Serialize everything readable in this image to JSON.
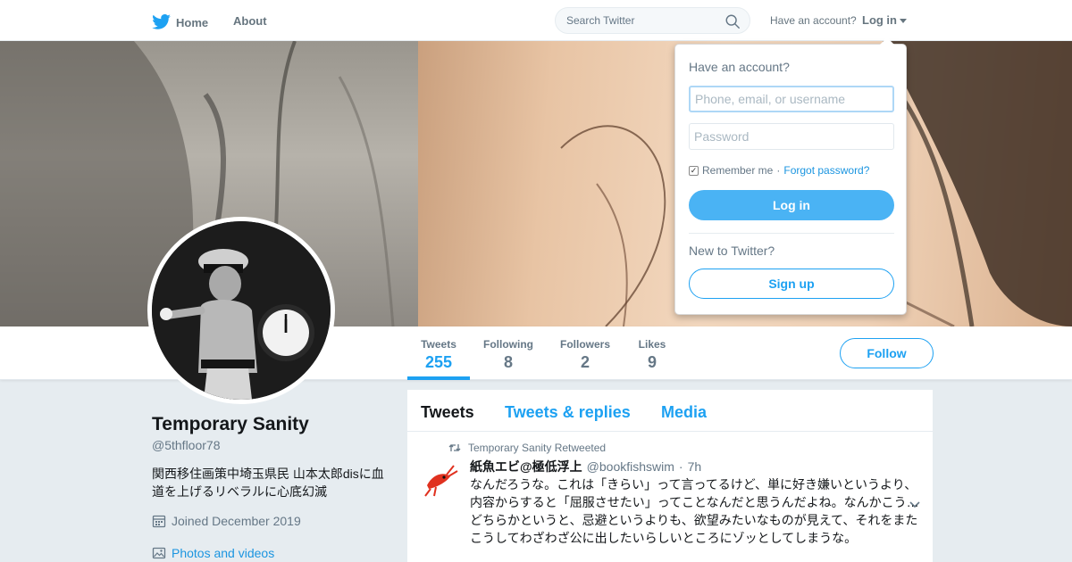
{
  "nav": {
    "home_label": "Home",
    "about_label": "About",
    "search_placeholder": "Search Twitter",
    "have_account": "Have an account?",
    "login_label": "Log in"
  },
  "profile": {
    "name": "Temporary Sanity",
    "handle": "@5thfloor78",
    "bio": "関西移住画策中埼玉県民 山本太郎disに血道を上げるリベラルに心底幻滅",
    "joined": "Joined December 2019",
    "photos_link": "Photos and videos"
  },
  "stats": [
    {
      "label": "Tweets",
      "value": "255"
    },
    {
      "label": "Following",
      "value": "8"
    },
    {
      "label": "Followers",
      "value": "2"
    },
    {
      "label": "Likes",
      "value": "9"
    }
  ],
  "follow_label": "Follow",
  "timeline": {
    "tabs": [
      "Tweets",
      "Tweets & replies",
      "Media"
    ],
    "tweet": {
      "retweeted_by": "Temporary Sanity Retweeted",
      "fullname": "紙魚エビ@極低浮上",
      "handle": "@bookfishswim",
      "separator": "·",
      "time": "7h",
      "lines": [
        "なんだろうな。これは「きらい」って言ってるけど、単に好き嫌いというより、",
        "内容からすると「屈服させたい」ってことなんだと思うんだよね。なんかこう…",
        "どちらかというと、忌避というよりも、欲望みたいなものが見えて、それをまた",
        "こうしてわざわざ公に出したいらしいところにゾッとしてしまうな。"
      ]
    }
  },
  "login_dropdown": {
    "title": "Have an account?",
    "username_placeholder": "Phone, email, or username",
    "password_placeholder": "Password",
    "remember": "Remember me",
    "separator": "·",
    "forgot": "Forgot password?",
    "login_button": "Log in",
    "new_to": "New to Twitter?",
    "signup_button": "Sign up"
  },
  "colors": {
    "brand": "#1da1f2",
    "login_button_bg": "#4ab3f4",
    "page_bg": "#e6ecf0"
  },
  "icons": [
    "twitter-bird-icon",
    "search-icon",
    "caret-down-icon",
    "calendar-icon",
    "image-icon",
    "retweet-icon",
    "chevron-down-icon"
  ]
}
